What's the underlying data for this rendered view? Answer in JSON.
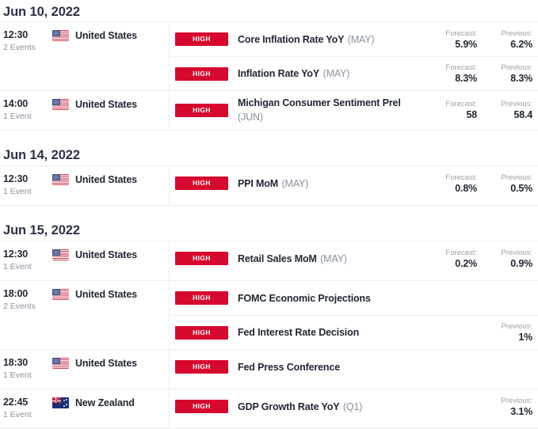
{
  "widget": {
    "name": "economic-calendar",
    "accent_color": "#d6082e",
    "heading_color": "#2c3347",
    "muted_color": "#8b909b",
    "divider_color": "#eceef1"
  },
  "labels": {
    "forecast": "Forecast:",
    "previous": "Previous:",
    "impact_high": "HIGH"
  },
  "date_groups": [
    {
      "date": "Jun 10, 2022",
      "time_blocks": [
        {
          "time": "12:30",
          "event_count": "2 Events",
          "country": "United States",
          "flag": "us-flag-icon",
          "events": [
            {
              "impact": "HIGH",
              "name": "Core Inflation Rate YoY",
              "period": "(MAY)",
              "forecast_label": "Forecast:",
              "forecast": "5.9%",
              "previous_label": "Previous:",
              "previous": "6.2%"
            },
            {
              "impact": "HIGH",
              "name": "Inflation Rate YoY",
              "period": "(MAY)",
              "forecast_label": "Forecast:",
              "forecast": "8.3%",
              "previous_label": "Previous:",
              "previous": "8.3%"
            }
          ]
        },
        {
          "time": "14:00",
          "event_count": "1 Event",
          "country": "United States",
          "flag": "us-flag-icon",
          "events": [
            {
              "impact": "HIGH",
              "name": "Michigan Consumer Sentiment Prel",
              "period": "(JUN)",
              "forecast_label": "Forecast:",
              "forecast": "58",
              "previous_label": "Previous:",
              "previous": "58.4"
            }
          ]
        }
      ]
    },
    {
      "date": "Jun 14, 2022",
      "time_blocks": [
        {
          "time": "12:30",
          "event_count": "1 Event",
          "country": "United States",
          "flag": "us-flag-icon",
          "events": [
            {
              "impact": "HIGH",
              "name": "PPI MoM",
              "period": "(MAY)",
              "forecast_label": "Forecast:",
              "forecast": "0.8%",
              "previous_label": "Previous:",
              "previous": "0.5%"
            }
          ]
        }
      ]
    },
    {
      "date": "Jun 15, 2022",
      "time_blocks": [
        {
          "time": "12:30",
          "event_count": "1 Event",
          "country": "United States",
          "flag": "us-flag-icon",
          "events": [
            {
              "impact": "HIGH",
              "name": "Retail Sales MoM",
              "period": "(MAY)",
              "forecast_label": "Forecast:",
              "forecast": "0.2%",
              "previous_label": "Previous:",
              "previous": "0.9%"
            }
          ]
        },
        {
          "time": "18:00",
          "event_count": "2 Events",
          "country": "United States",
          "flag": "us-flag-icon",
          "events": [
            {
              "impact": "HIGH",
              "name": "FOMC Economic Projections",
              "period": "",
              "forecast_label": "",
              "forecast": "",
              "previous_label": "",
              "previous": ""
            },
            {
              "impact": "HIGH",
              "name": "Fed Interest Rate Decision",
              "period": "",
              "forecast_label": "",
              "forecast": "",
              "previous_label": "Previous:",
              "previous": "1%"
            }
          ]
        },
        {
          "time": "18:30",
          "event_count": "1 Event",
          "country": "United States",
          "flag": "us-flag-icon",
          "events": [
            {
              "impact": "HIGH",
              "name": "Fed Press Conference",
              "period": "",
              "forecast_label": "",
              "forecast": "",
              "previous_label": "",
              "previous": ""
            }
          ]
        },
        {
          "time": "22:45",
          "event_count": "1 Event",
          "country": "New Zealand",
          "flag": "nz-flag-icon",
          "events": [
            {
              "impact": "HIGH",
              "name": "GDP Growth Rate YoY",
              "period": "(Q1)",
              "forecast_label": "",
              "forecast": "",
              "previous_label": "Previous:",
              "previous": "3.1%"
            }
          ]
        }
      ]
    }
  ]
}
